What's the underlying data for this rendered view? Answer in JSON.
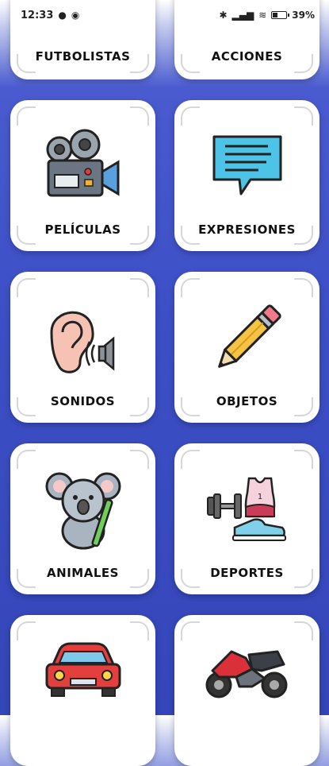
{
  "status_bar": {
    "time": "12:33",
    "battery": "39",
    "battery_level": 0.39
  },
  "categories": [
    {
      "label": "FUTBOLISTAS",
      "icon": "soccer-player-icon"
    },
    {
      "label": "ACCIONES",
      "icon": "action-icon"
    },
    {
      "label": "PELÍCULAS",
      "icon": "movie-camera-icon"
    },
    {
      "label": "EXPRESIONES",
      "icon": "speech-bubble-icon"
    },
    {
      "label": "SONIDOS",
      "icon": "ear-speaker-icon"
    },
    {
      "label": "OBJETOS",
      "icon": "pencil-icon"
    },
    {
      "label": "ANIMALES",
      "icon": "koala-icon"
    },
    {
      "label": "DEPORTES",
      "icon": "sports-gear-icon"
    },
    {
      "label": "",
      "icon": "car-icon"
    },
    {
      "label": "",
      "icon": "motorcycle-icon"
    }
  ]
}
